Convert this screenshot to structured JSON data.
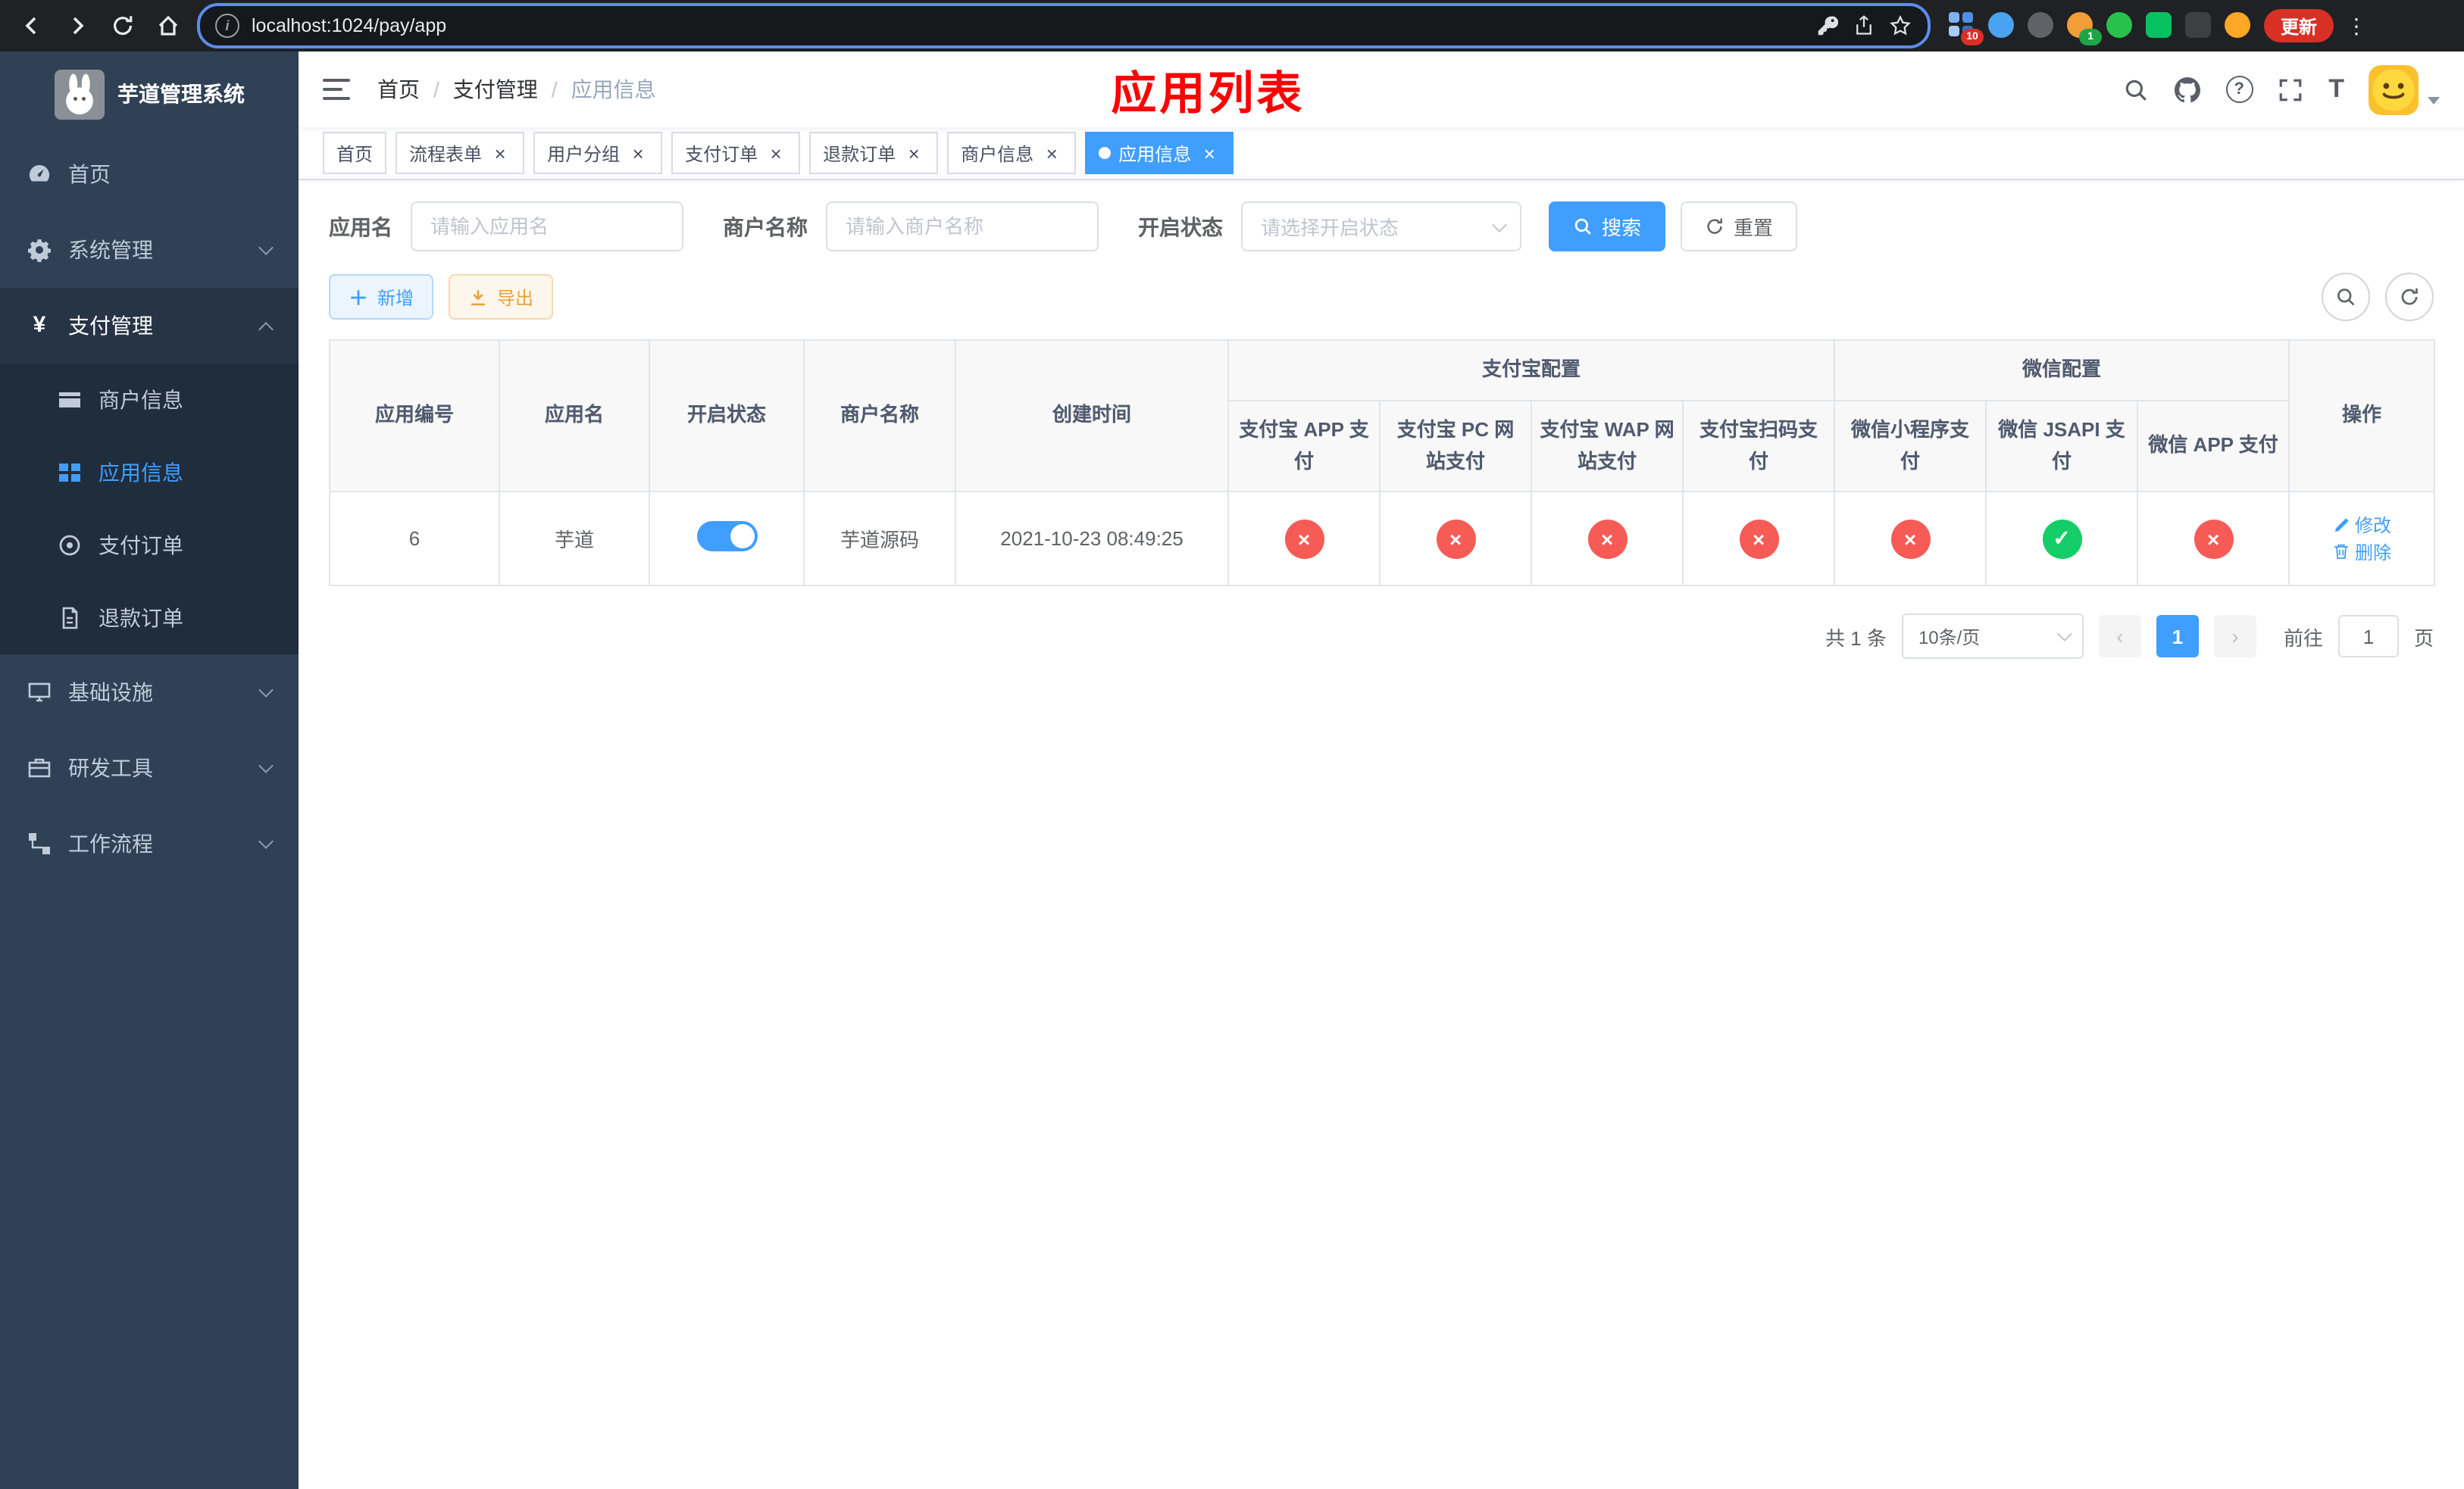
{
  "browser": {
    "url": "localhost:1024/pay/app",
    "update_button": "更新",
    "extension_badge_1": "10",
    "extension_badge_2": "1"
  },
  "icons": {
    "close": "×",
    "yen": "¥",
    "prev": "‹",
    "next": "›",
    "ok_glyph": "✓",
    "fail_glyph": "×",
    "font_size": "T",
    "question": "?",
    "dots": "⋮",
    "info": "i"
  },
  "sidebar": {
    "title": "芋道管理系统",
    "items": [
      {
        "label": "首页"
      },
      {
        "label": "系统管理"
      },
      {
        "label": "支付管理"
      },
      {
        "label": "商户信息"
      },
      {
        "label": "应用信息"
      },
      {
        "label": "支付订单"
      },
      {
        "label": "退款订单"
      },
      {
        "label": "基础设施"
      },
      {
        "label": "研发工具"
      },
      {
        "label": "工作流程"
      }
    ]
  },
  "breadcrumb": {
    "items": [
      "首页",
      "支付管理",
      "应用信息"
    ],
    "separator": "/"
  },
  "annotation": "应用列表",
  "tabs": [
    {
      "label": "首页"
    },
    {
      "label": "流程表单"
    },
    {
      "label": "用户分组"
    },
    {
      "label": "支付订单"
    },
    {
      "label": "退款订单"
    },
    {
      "label": "商户信息"
    },
    {
      "label": "应用信息"
    }
  ],
  "filters": {
    "app_name_label": "应用名",
    "app_name_placeholder": "请输入应用名",
    "merchant_label": "商户名称",
    "merchant_placeholder": "请输入商户名称",
    "status_label": "开启状态",
    "status_placeholder": "请选择开启状态",
    "search_button": "搜索",
    "reset_button": "重置"
  },
  "toolbar": {
    "add_button": "新增",
    "export_button": "导出"
  },
  "table": {
    "plain_headers": [
      "应用编号",
      "应用名",
      "开启状态",
      "商户名称",
      "创建时间"
    ],
    "alipay_group": {
      "label": "支付宝配置",
      "columns": [
        "支付宝 APP 支付",
        "支付宝 PC 网站支付",
        "支付宝 WAP 网站支付",
        "支付宝扫码支付"
      ]
    },
    "wechat_group": {
      "label": "微信配置",
      "columns": [
        "微信小程序支付",
        "微信 JSAPI 支付",
        "微信 APP 支付"
      ]
    },
    "action_header": "操作",
    "row": {
      "id": "6",
      "name": "芋道",
      "enabled": true,
      "merchant": "芋道源码",
      "created": "2021-10-23 08:49:25",
      "statuses": [
        false,
        false,
        false,
        false,
        false,
        true,
        false
      ],
      "edit": "修改",
      "delete": "删除"
    }
  },
  "pagination": {
    "total": "共 1 条",
    "page_size": "10条/页",
    "page": "1",
    "goto_prefix": "前往",
    "goto_value": "1",
    "goto_suffix": "页"
  },
  "colors": {
    "primary": "#409eff",
    "success": "#13ce66",
    "danger": "#f75b56",
    "sidebar_bg": "#304156",
    "submenu_bg": "#1f2d3d",
    "annotation_red": "#fe0000"
  }
}
